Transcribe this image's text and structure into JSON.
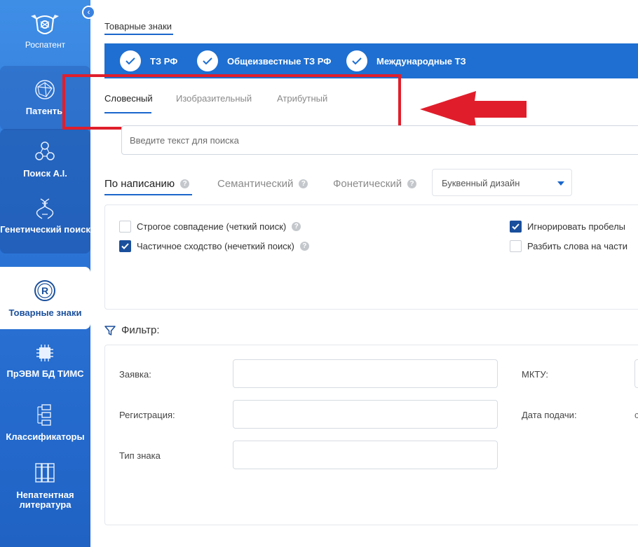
{
  "sidebar": {
    "logo_label": "Роспатент",
    "collapse_icon": "arrow-left-circle-icon",
    "items": [
      {
        "label": "Патенты",
        "icon": "globe-network-icon"
      },
      {
        "label": "Поиск A.I.",
        "icon": "ai-nodes-icon"
      },
      {
        "label": "Генетический поиск",
        "icon": "dna-icon"
      },
      {
        "label": "Товарные знаки",
        "icon": "registered-mark-icon",
        "active": true
      },
      {
        "label": "ПрЭВМ БД ТИМС",
        "icon": "chip-icon"
      },
      {
        "label": "Классификаторы",
        "icon": "hierarchy-icon"
      },
      {
        "label": "Непатентная литература",
        "icon": "books-icon"
      }
    ]
  },
  "breadcrumb": "Товарные знаки",
  "topbar": {
    "items": [
      {
        "label": "ТЗ РФ",
        "checked": true
      },
      {
        "label": "Общеизвестные ТЗ РФ",
        "checked": true
      },
      {
        "label": "Международные ТЗ",
        "checked": true
      }
    ]
  },
  "tabs": {
    "items": [
      "Словесный",
      "Изобразительный",
      "Атрибутный"
    ],
    "active": "Словесный"
  },
  "search": {
    "placeholder": "Введите текст для поиска",
    "value": ""
  },
  "modes": {
    "items": [
      "По написанию",
      "Семантический",
      "Фонетический"
    ],
    "active": "По написанию",
    "select_value": "Буквенный дизайн"
  },
  "options": {
    "left": [
      {
        "label": "Строгое совпадение (четкий поиск)",
        "checked": false
      },
      {
        "label": "Частичное сходство (нечеткий поиск)",
        "checked": true
      }
    ],
    "right": [
      {
        "label": "Игнорировать пробелы",
        "checked": true
      },
      {
        "label": "Разбить слова на части",
        "checked": false
      }
    ]
  },
  "filter": {
    "title": "Фильтр:",
    "fields": {
      "application": "Заявка:",
      "registration": "Регистрация:",
      "mark_type": "Тип знака",
      "mktu": "МКТУ:",
      "filing_date": "Дата подачи:",
      "filing_date_prefix": "с"
    }
  },
  "colors": {
    "accent": "#1e6fd1",
    "highlight": "#e01e2b",
    "sidebar": "#2b74d6"
  }
}
